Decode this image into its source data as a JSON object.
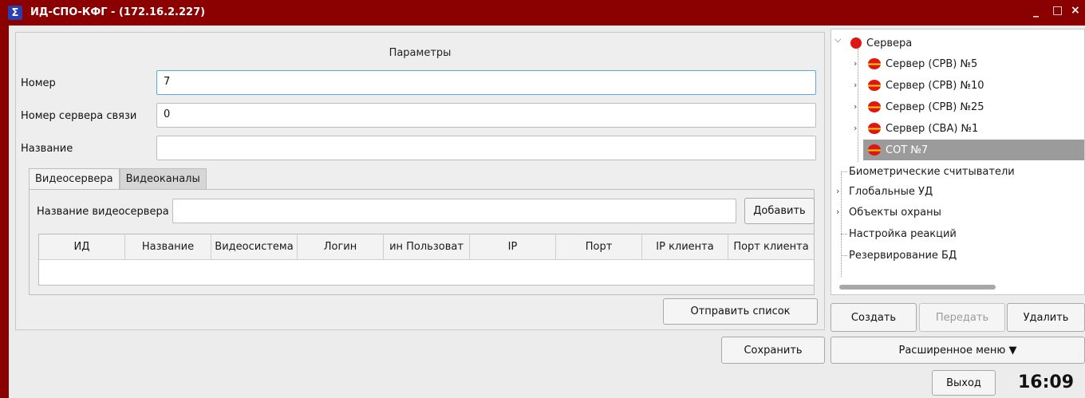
{
  "window": {
    "title": "ИД-СПО-КФГ -  (172.16.2.227)",
    "minimize": "_",
    "maximize": "□",
    "close": "×"
  },
  "params": {
    "title": "Параметры",
    "number_label": "Номер",
    "number_value": "7",
    "server_number_label": "Номер сервера связи",
    "server_number_value": "0",
    "name_label": "Название",
    "name_value": ""
  },
  "tabs": {
    "videoservers": "Видеосервера",
    "videochannels": "Видеоканалы"
  },
  "videoserver": {
    "name_label": "Название видеосервера",
    "name_value": "",
    "add_button": "Добавить",
    "columns": [
      "ИД",
      "Название",
      "Видеосистема",
      "Логин",
      "ин Пользоват",
      "IP",
      "Порт",
      "IP клиента",
      "Порт клиента"
    ]
  },
  "buttons": {
    "send_list": "Отправить список",
    "save": "Сохранить",
    "create": "Создать",
    "transfer": "Передать",
    "delete": "Удалить",
    "extended_menu": "Расширенное меню ▼",
    "exit": "Выход"
  },
  "tree": {
    "root": "Сервера",
    "servers": [
      "Сервер (СРВ) №5",
      "Сервер (СРВ) №10",
      "Сервер (СРВ) №25",
      "Сервер (СВА) №1"
    ],
    "selected": "СОТ №7",
    "items": [
      "Биометрические считыватели",
      "Глобальные УД",
      "Объекты охраны",
      "Настройка реакций",
      "Резервирование БД"
    ]
  },
  "clock": "16:09",
  "colors": {
    "titlebar": "#8b0000",
    "selection": "#9b9b9b",
    "status_red": "#e01515",
    "status_yellow": "#f4d200"
  }
}
